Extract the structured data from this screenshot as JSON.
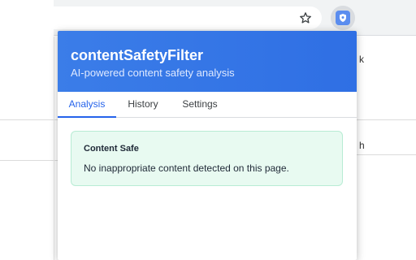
{
  "browser": {
    "star_icon": "star-icon",
    "extension_icon": "shield-icon"
  },
  "background": {
    "glyph_a": "k",
    "glyph_b": "h"
  },
  "popup": {
    "title": "contentSafetyFilter",
    "subtitle": "AI-powered content safety analysis",
    "tabs": [
      {
        "label": "Analysis",
        "active": true
      },
      {
        "label": "History",
        "active": false
      },
      {
        "label": "Settings",
        "active": false
      }
    ],
    "status": {
      "title": "Content Safe",
      "message": "No inappropriate content detected on this page."
    }
  },
  "colors": {
    "header": "#3b7de8",
    "accent": "#2563eb",
    "safe_bg": "#e8faf1",
    "safe_border": "#b8ecd4"
  }
}
